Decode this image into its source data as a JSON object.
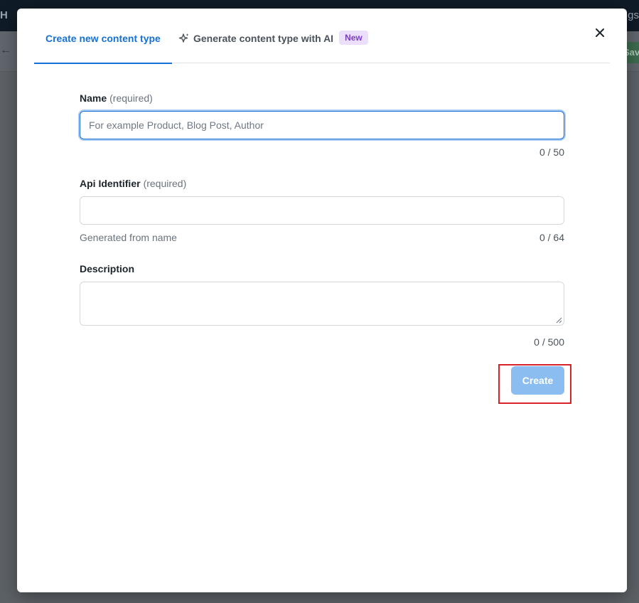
{
  "background": {
    "topbar_left": "H",
    "topbar_right": "gs",
    "save_fragment": "Sav"
  },
  "tabs": [
    {
      "label": "Create new content type",
      "active": true
    },
    {
      "label": "Generate content type with AI",
      "badge": "New",
      "icon": "sparkle-icon",
      "active": false
    }
  ],
  "close": {
    "icon": "close-icon"
  },
  "form": {
    "name": {
      "label": "Name",
      "required_text": "(required)",
      "placeholder": "For example Product, Blog Post, Author",
      "value": "",
      "counter": "0 / 50"
    },
    "api_identifier": {
      "label": "Api Identifier",
      "required_text": "(required)",
      "value": "",
      "helper": "Generated from name",
      "counter": "0 / 64"
    },
    "description": {
      "label": "Description",
      "value": "",
      "counter": "0 / 500"
    }
  },
  "actions": {
    "create_label": "Create"
  },
  "colors": {
    "accent": "#1671d6",
    "button_disabled": "#8cbdf1",
    "badge_bg": "#ecdffb",
    "badge_text": "#7b3fc4",
    "highlight": "#d9232b"
  }
}
